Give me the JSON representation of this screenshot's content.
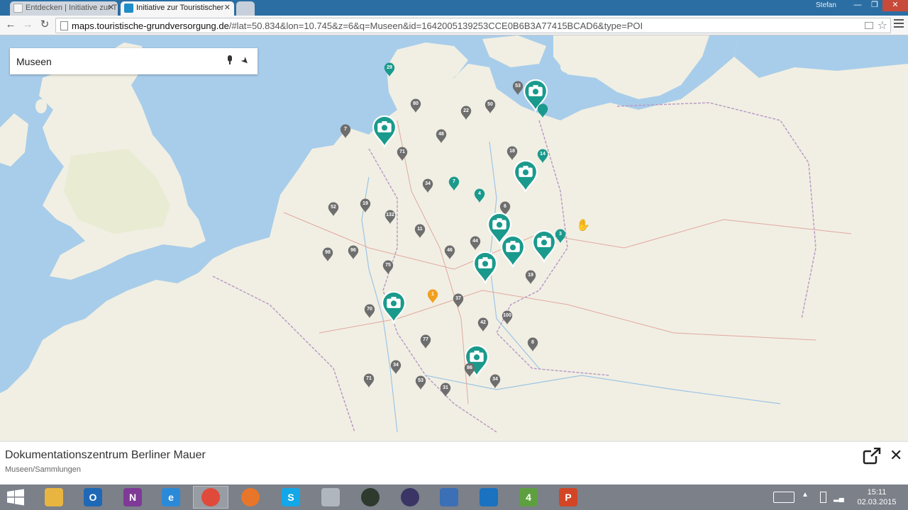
{
  "browser": {
    "tabs": [
      {
        "title": "Entdecken | Initiative zur T",
        "active": false
      },
      {
        "title": "Initiative zur Touristischer",
        "active": true
      }
    ],
    "user": "Stefan",
    "url_host": "maps.touristische-grundversorgung.de",
    "url_rest": "/#lat=50.834&lon=10.745&z=6&q=Museen&id=1642005139253CCE0B6B3A77415BCAD6&type=POI"
  },
  "map": {
    "search_query": "Museen",
    "accent_color": "#1a9a8c",
    "cluster_color": "#6e6e6e",
    "highlight_color": "#f0a020",
    "markers": [
      {
        "kind": "cluster",
        "label": "29",
        "teal": true
      },
      {
        "kind": "cluster",
        "label": "53"
      },
      {
        "kind": "poi"
      },
      {
        "kind": "cluster",
        "label": "",
        "teal": true
      },
      {
        "kind": "cluster",
        "label": "80"
      },
      {
        "kind": "cluster",
        "label": "22"
      },
      {
        "kind": "cluster",
        "label": "50"
      },
      {
        "kind": "poi"
      },
      {
        "kind": "cluster",
        "label": "7"
      },
      {
        "kind": "cluster",
        "label": "48"
      },
      {
        "kind": "cluster",
        "label": "71"
      },
      {
        "kind": "cluster",
        "label": "18"
      },
      {
        "kind": "cluster",
        "label": "14",
        "teal": true
      },
      {
        "kind": "poi"
      },
      {
        "kind": "cluster",
        "label": "34"
      },
      {
        "kind": "cluster",
        "label": "7",
        "teal": true
      },
      {
        "kind": "cluster",
        "label": "4",
        "teal": true
      },
      {
        "kind": "cluster",
        "label": "52"
      },
      {
        "kind": "cluster",
        "label": "19"
      },
      {
        "kind": "cluster",
        "label": "6"
      },
      {
        "kind": "cluster",
        "label": "132"
      },
      {
        "kind": "poi"
      },
      {
        "kind": "cluster",
        "label": "11"
      },
      {
        "kind": "poi"
      },
      {
        "kind": "poi"
      },
      {
        "kind": "cluster",
        "label": "3",
        "teal": true
      },
      {
        "kind": "cluster",
        "label": "44"
      },
      {
        "kind": "cluster",
        "label": "46"
      },
      {
        "kind": "cluster",
        "label": "98"
      },
      {
        "kind": "cluster",
        "label": "96"
      },
      {
        "kind": "poi"
      },
      {
        "kind": "cluster",
        "label": "75"
      },
      {
        "kind": "cluster",
        "label": "19"
      },
      {
        "kind": "poi"
      },
      {
        "kind": "cluster",
        "label": "1",
        "orange": true
      },
      {
        "kind": "cluster",
        "label": "37"
      },
      {
        "kind": "cluster",
        "label": "70"
      },
      {
        "kind": "cluster",
        "label": "100"
      },
      {
        "kind": "cluster",
        "label": "42"
      },
      {
        "kind": "cluster",
        "label": "77"
      },
      {
        "kind": "cluster",
        "label": "8"
      },
      {
        "kind": "poi"
      },
      {
        "kind": "cluster",
        "label": "34"
      },
      {
        "kind": "cluster",
        "label": "86"
      },
      {
        "kind": "cluster",
        "label": "71"
      },
      {
        "kind": "cluster",
        "label": "53"
      },
      {
        "kind": "cluster",
        "label": "34"
      },
      {
        "kind": "cluster",
        "label": "31"
      }
    ]
  },
  "info_panel": {
    "title": "Dokumentationszentrum Berliner Mauer",
    "category": "Museen/Sammlungen"
  },
  "taskbar": {
    "apps": [
      {
        "name": "file-explorer",
        "color": "#e8b540",
        "glyph": ""
      },
      {
        "name": "outlook",
        "color": "#1e68b6",
        "glyph": "O"
      },
      {
        "name": "onenote",
        "color": "#7e3a96",
        "glyph": "N"
      },
      {
        "name": "internet-explorer",
        "color": "#2a8ad8",
        "glyph": "e"
      },
      {
        "name": "chrome",
        "color": "#e04a3a",
        "glyph": ""
      },
      {
        "name": "firefox",
        "color": "#e8762a",
        "glyph": ""
      },
      {
        "name": "skype",
        "color": "#12a7e8",
        "glyph": "S"
      },
      {
        "name": "snipping-tool",
        "color": "#b0b6be",
        "glyph": ""
      },
      {
        "name": "spotify",
        "color": "#2e3a2e",
        "glyph": ""
      },
      {
        "name": "eclipse",
        "color": "#3a3565",
        "glyph": ""
      },
      {
        "name": "network-app",
        "color": "#3b6fb6",
        "glyph": ""
      },
      {
        "name": "teamviewer",
        "color": "#1a72c0",
        "glyph": ""
      },
      {
        "name": "camtasia",
        "color": "#5ea040",
        "glyph": "4"
      },
      {
        "name": "powerpoint",
        "color": "#d24625",
        "glyph": "P"
      }
    ],
    "time": "15:11",
    "date": "02.03.2015"
  }
}
